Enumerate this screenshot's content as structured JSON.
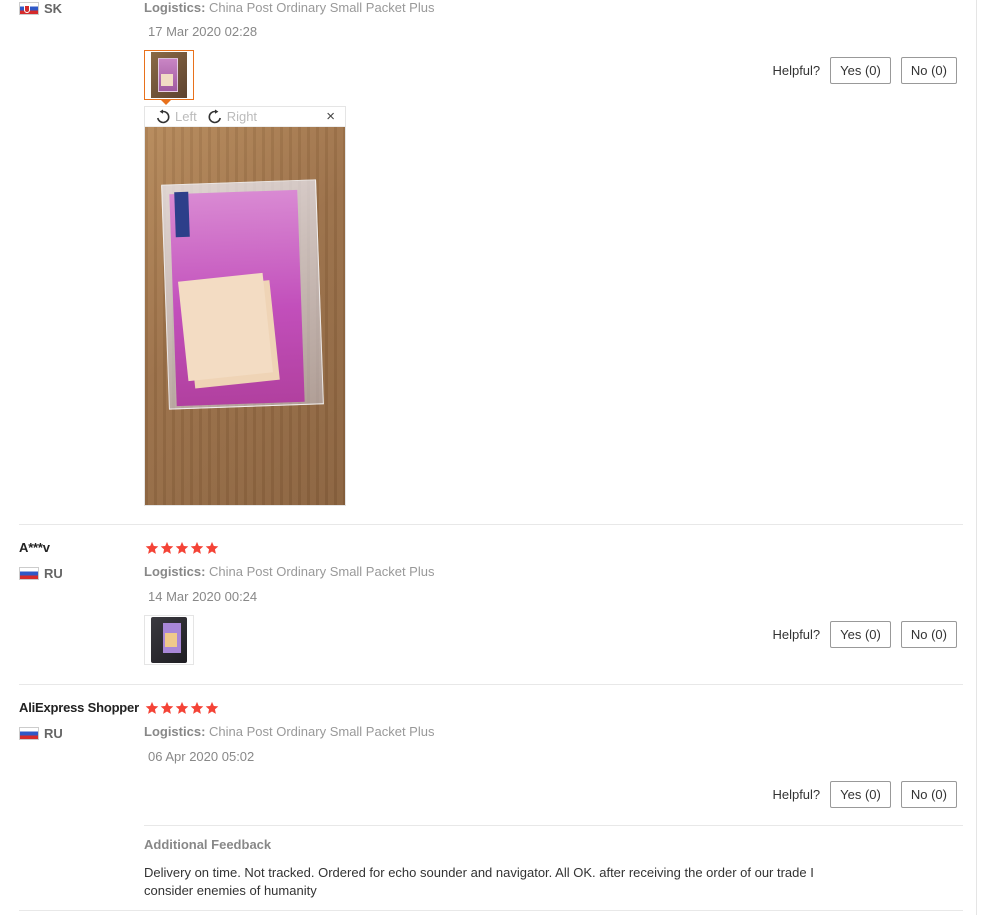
{
  "review1": {
    "country": "SK",
    "logistics_label": "Logistics:",
    "logistics_value": "China Post Ordinary Small Packet Plus",
    "date": "17 Mar 2020 02:28",
    "helpful_label": "Helpful?",
    "yes_label": "Yes (0)",
    "no_label": "No (0)",
    "viewer": {
      "rotate_left": "Left",
      "rotate_right": "Right",
      "close": "×"
    }
  },
  "review2": {
    "user": "A***v",
    "country": "RU",
    "rating": 5,
    "logistics_label": "Logistics:",
    "logistics_value": "China Post Ordinary Small Packet Plus",
    "date": "14 Mar 2020 00:24",
    "helpful_label": "Helpful?",
    "yes_label": "Yes (0)",
    "no_label": "No (0)"
  },
  "review3": {
    "user": "AliExpress Shopper",
    "country": "RU",
    "rating": 5,
    "logistics_label": "Logistics:",
    "logistics_value": "China Post Ordinary Small Packet Plus",
    "date": "06 Apr 2020 05:02",
    "helpful_label": "Helpful?",
    "yes_label": "Yes (0)",
    "no_label": "No (0)",
    "additional_title": "Additional Feedback",
    "additional_text": "Delivery on time. Not tracked. Ordered for echo sounder and navigator. All OK. after receiving the order of our trade I consider enemies of humanity"
  },
  "colors": {
    "star": "#f44336",
    "thumb_active_border": "#e8711c"
  },
  "icons": {
    "star": "star-icon",
    "rotate_left": "rotate-left-icon",
    "rotate_right": "rotate-right-icon",
    "close": "close-icon"
  }
}
